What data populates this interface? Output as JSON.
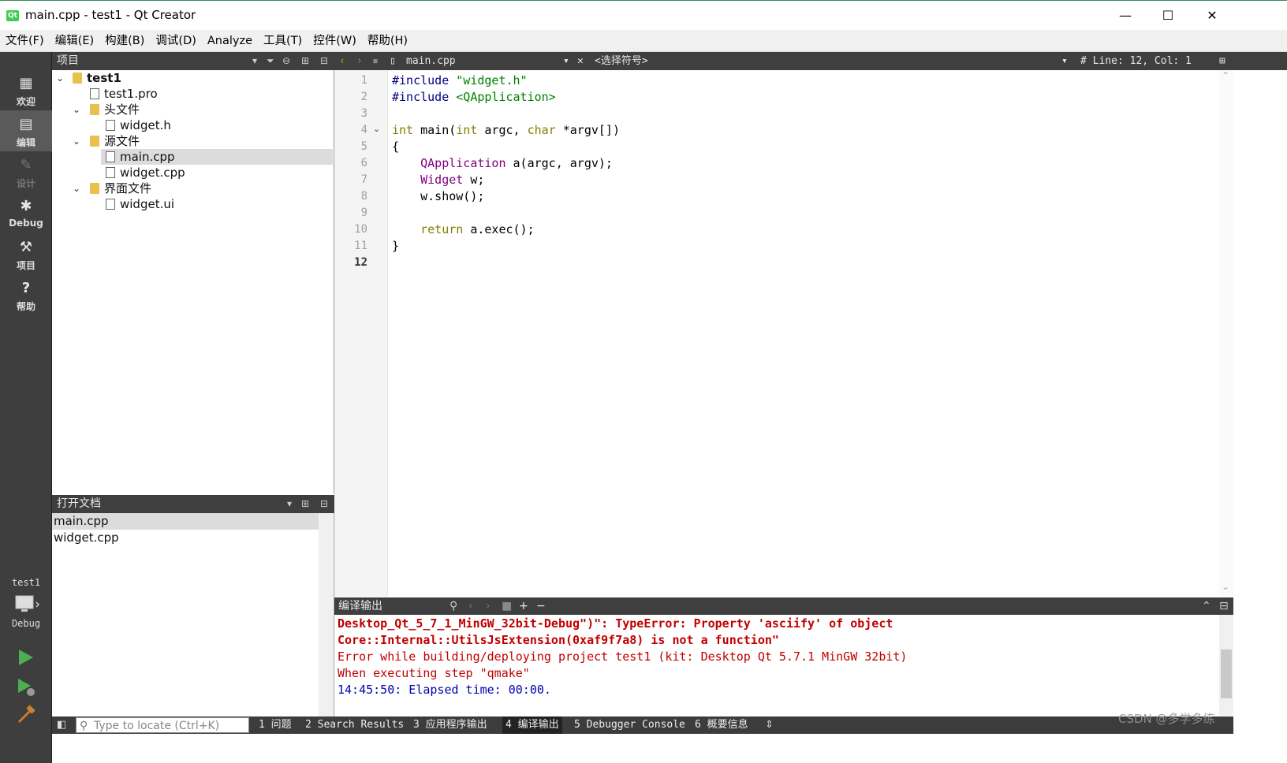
{
  "window": {
    "title": "main.cpp - test1 - Qt Creator",
    "app_logo_text": "Qt",
    "minimize_glyph": "—",
    "maximize_glyph": "☐",
    "close_glyph": "✕"
  },
  "menu": [
    "文件(F)",
    "编辑(E)",
    "构建(B)",
    "调试(D)",
    "Analyze",
    "工具(T)",
    "控件(W)",
    "帮助(H)"
  ],
  "modes": [
    {
      "label": "欢迎",
      "icon": "grid-icon"
    },
    {
      "label": "编辑",
      "icon": "edit-icon"
    },
    {
      "label": "设计",
      "icon": "pencil-icon"
    },
    {
      "label": "Debug",
      "icon": "bug-icon"
    },
    {
      "label": "项目",
      "icon": "wrench-icon"
    },
    {
      "label": "帮助",
      "icon": "help-icon"
    }
  ],
  "kit": {
    "project": "test1",
    "build": "Debug"
  },
  "project_pane": {
    "title": "项目",
    "tree": [
      {
        "label": "test1",
        "level": 0,
        "expanded": true,
        "bold": true
      },
      {
        "label": "test1.pro",
        "level": 1
      },
      {
        "label": "头文件",
        "level": 1,
        "expanded": true
      },
      {
        "label": "widget.h",
        "level": 2
      },
      {
        "label": "源文件",
        "level": 1,
        "expanded": true
      },
      {
        "label": "main.cpp",
        "level": 2,
        "selected": true
      },
      {
        "label": "widget.cpp",
        "level": 2
      },
      {
        "label": "界面文件",
        "level": 1,
        "expanded": true
      },
      {
        "label": "widget.ui",
        "level": 2
      }
    ]
  },
  "open_docs": {
    "title": "打开文档",
    "items": [
      {
        "label": "main.cpp",
        "selected": true
      },
      {
        "label": "widget.cpp"
      }
    ]
  },
  "editor": {
    "file": "main.cpp",
    "symbol": "<选择符号>",
    "position": "#  Line: 12, Col: 1",
    "line_numbers": [
      "1",
      "2",
      "3",
      "4",
      "5",
      "6",
      "7",
      "8",
      "9",
      "10",
      "11",
      "12"
    ],
    "current_line": 12,
    "lines": [
      [
        {
          "t": "#include ",
          "c": "pp"
        },
        {
          "t": "\"widget.h\"",
          "c": "str"
        }
      ],
      [
        {
          "t": "#include ",
          "c": "pp"
        },
        {
          "t": "<QApplication>",
          "c": "str"
        }
      ],
      [],
      [
        {
          "t": "int",
          "c": "kw"
        },
        {
          "t": " main(",
          "c": ""
        },
        {
          "t": "int",
          "c": "kw"
        },
        {
          "t": " argc, ",
          "c": ""
        },
        {
          "t": "char",
          "c": "kw"
        },
        {
          "t": " *argv[])",
          "c": ""
        }
      ],
      [
        {
          "t": "{",
          "c": ""
        }
      ],
      [
        {
          "t": "    ",
          "c": ""
        },
        {
          "t": "QApplication",
          "c": "ty"
        },
        {
          "t": " a(argc, argv);",
          "c": ""
        }
      ],
      [
        {
          "t": "    ",
          "c": ""
        },
        {
          "t": "Widget",
          "c": "ty"
        },
        {
          "t": " w;",
          "c": ""
        }
      ],
      [
        {
          "t": "    w.show();",
          "c": ""
        }
      ],
      [],
      [
        {
          "t": "    ",
          "c": ""
        },
        {
          "t": "return",
          "c": "kw"
        },
        {
          "t": " a.exec();",
          "c": ""
        }
      ],
      [
        {
          "t": "}",
          "c": ""
        }
      ],
      []
    ]
  },
  "output": {
    "title": "编译输出",
    "lines": [
      {
        "t": "Desktop_Qt_5_7_1_MinGW_32bit-Debug\")\": TypeError: Property 'asciify' of object",
        "c": "errb"
      },
      {
        "t": "Core::Internal::UtilsJsExtension(0xaf9f7a8) is not a function\"",
        "c": "errb"
      },
      {
        "t": "Error while building/deploying project test1 (kit: Desktop Qt 5.7.1 MinGW 32bit)",
        "c": "err"
      },
      {
        "t": "When executing step \"qmake\"",
        "c": "err"
      },
      {
        "t": "14:45:50: Elapsed time: 00:00.",
        "c": "info"
      }
    ]
  },
  "statusbar": {
    "locator_placeholder": "Type to locate (Ctrl+K)",
    "tabs": [
      "1 问题",
      "2 Search Results",
      "3 应用程序输出",
      "4 编译输出",
      "5 Debugger Console",
      "6 概要信息"
    ],
    "active_tab": 3
  },
  "watermark": "CSDN @多学多练"
}
